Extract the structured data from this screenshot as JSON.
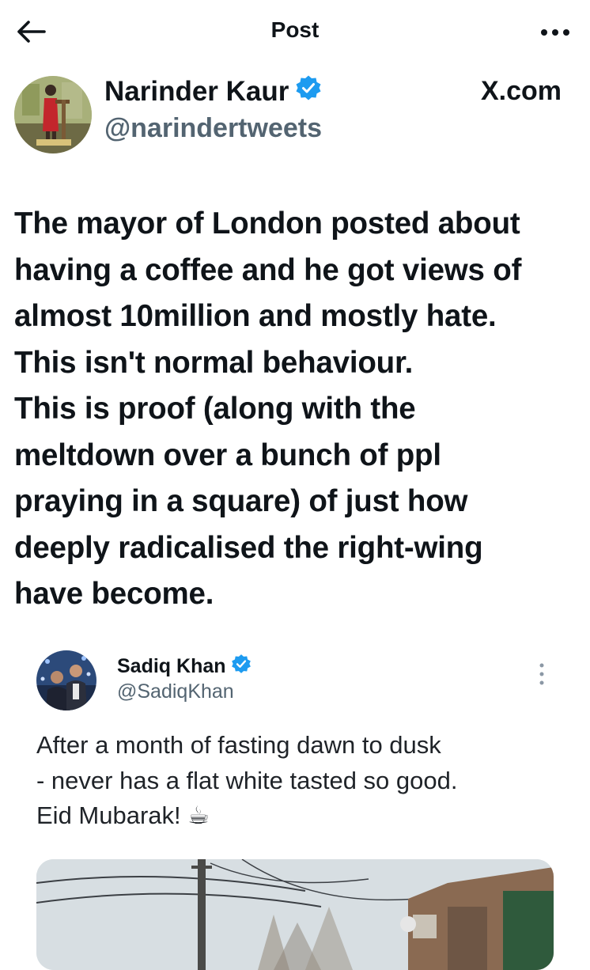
{
  "header": {
    "title": "Post",
    "back_icon": "back-arrow-icon",
    "more_icon": "more-horizontal-icon"
  },
  "post": {
    "author_name": "Narinder Kaur",
    "verified_icon": "verified-badge-icon",
    "author_handle": "@narindertweets",
    "source": "X.com",
    "text": "The mayor of London posted about\nhaving a coffee and he got views of\nalmost 10million and mostly hate.\nThis isn't normal behaviour.\nThis is proof (along with the\nmeltdown over a bunch of ppl\npraying in a square) of just how\ndeeply radicalised the right-wing\nhave become."
  },
  "quoted": {
    "author_name": "Sadiq Khan",
    "author_handle": "@SadiqKhan",
    "text": "After a month of fasting dawn to dusk\n- never has a flat white tasted so good.\nEid Mubarak! ☕",
    "more_icon": "more-vertical-icon"
  },
  "colors": {
    "verified": "#1d9bf0",
    "text": "#0f1419",
    "secondary": "#536471"
  }
}
